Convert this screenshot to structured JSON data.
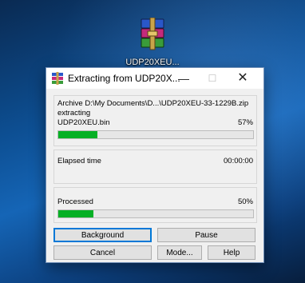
{
  "desktop": {
    "icon_label": "UDP20XEU..."
  },
  "window": {
    "title": "Extracting from UDP20X...",
    "controls": {
      "minimize": "—",
      "maximize": "☐",
      "close": "✕"
    }
  },
  "archive_panel": {
    "archive_line": "Archive D:\\My Documents\\D...\\UDP20XEU-33-1229B.zip",
    "action": "extracting",
    "file_name": "UDP20XEU.bin",
    "file_percent": "57%",
    "file_progress": 0.2
  },
  "time_panel": {
    "elapsed_label": "Elapsed time",
    "elapsed_value": "00:00:00"
  },
  "processed_panel": {
    "label": "Processed",
    "percent": "50%",
    "progress": 0.18
  },
  "buttons": {
    "background": "Background",
    "pause": "Pause",
    "cancel": "Cancel",
    "mode": "Mode...",
    "help": "Help"
  },
  "colors": {
    "progress_fill": "#06b025",
    "default_button_border": "#0078d7"
  },
  "icons": {
    "desktop_icon": "winrar-archive-icon",
    "window_icon": "winrar-icon"
  }
}
